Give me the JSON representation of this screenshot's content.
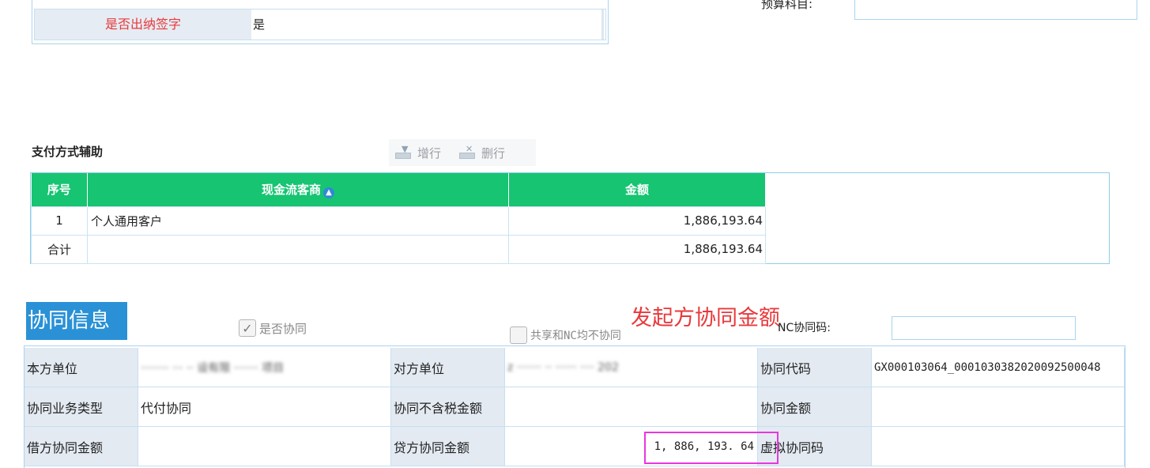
{
  "top": {
    "signature_label": "是否出纳签字",
    "signature_value": "是",
    "budget_label": "预算科目:"
  },
  "payment": {
    "title": "支付方式辅助",
    "toolbar": {
      "add_row": "增行",
      "delete_row": "删行"
    },
    "columns": [
      "序号",
      "现金流客商",
      "金额"
    ],
    "rows": [
      {
        "idx": "1",
        "name": "个人通用客户",
        "amount": "1,886,193.64"
      }
    ],
    "total": {
      "label": "合计",
      "amount": "1,886,193.64"
    }
  },
  "synergy": {
    "title": "协同信息",
    "checkbox_synergy": "是否协同",
    "checkbox_shared": "共享和NC均不协同",
    "annotation": "发起方协同金额",
    "nc_code_label": "NC协同码:",
    "fields": {
      "own_unit_label": "本方单位",
      "own_unit_value": "········ ··· ·· 设有限 ······· 项目",
      "counterparty_label": "对方单位",
      "counterparty_value": "z ······· ·· ······ ···· 202",
      "code_label": "协同代码",
      "code_value": "GX000103064_0001030382020092500048",
      "biz_type_label": "协同业务类型",
      "biz_type_value": "代付协同",
      "excl_tax_label": "协同不含税金额",
      "amount_label": "协同金额",
      "debit_label": "借方协同金额",
      "credit_label": "贷方协同金额",
      "credit_value": "1, 886, 193. 64",
      "virtual_code_label": "虚拟协同码"
    }
  },
  "colors": {
    "header_green": "#16c472",
    "title_blue": "#2a91d6",
    "label_red": "#e8393b",
    "highlight_magenta": "#e936e0"
  }
}
